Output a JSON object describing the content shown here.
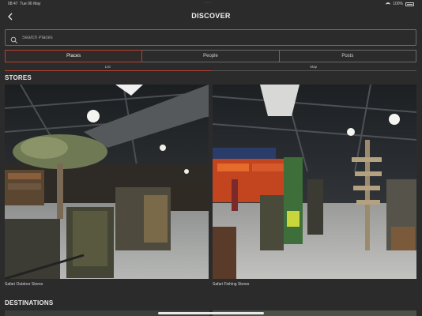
{
  "status_bar": {
    "time": "08:47",
    "date": "Tue 06 May",
    "battery": "100%"
  },
  "header": {
    "title": "DISCOVER"
  },
  "search": {
    "placeholder": "Search Places"
  },
  "segments": [
    {
      "label": "Places",
      "active": true
    },
    {
      "label": "People",
      "active": false
    },
    {
      "label": "Posts",
      "active": false
    }
  ],
  "view_tabs": [
    {
      "label": "List",
      "active": true
    },
    {
      "label": "Map",
      "active": false
    }
  ],
  "stores": {
    "heading": "STORES",
    "items": [
      {
        "name": "Safari Outdoor Stores"
      },
      {
        "name": "Safari Fishing Stores"
      }
    ]
  },
  "destinations": {
    "heading": "DESTINATIONS"
  },
  "colors": {
    "accent": "#b8402f",
    "background": "#2b2b2b",
    "border": "#6a6a6a"
  },
  "icons": {
    "back": "chevron-left-icon",
    "search": "search-icon"
  }
}
